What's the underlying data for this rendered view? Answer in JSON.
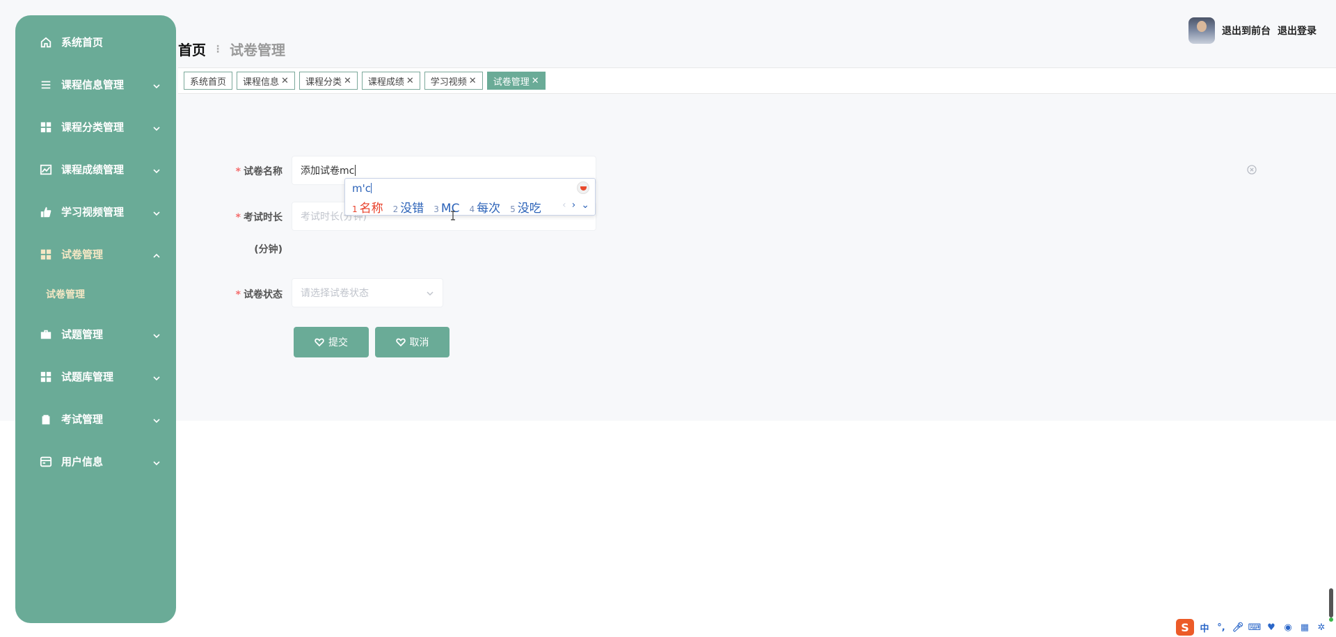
{
  "colors": {
    "accent": "#6aab97",
    "active_text": "#f5e7c4",
    "required": "#f56c6c",
    "ime_blue": "#2b62b8",
    "ime_red": "#e8402a"
  },
  "sidebar": {
    "items": [
      {
        "label": "系统首页",
        "icon": "home-icon"
      },
      {
        "label": "课程信息管理",
        "icon": "list-icon"
      },
      {
        "label": "课程分类管理",
        "icon": "grid-icon"
      },
      {
        "label": "课程成绩管理",
        "icon": "chart-icon"
      },
      {
        "label": "学习视频管理",
        "icon": "thumb-icon"
      },
      {
        "label": "试卷管理",
        "icon": "grid-icon"
      },
      {
        "label": "试题管理",
        "icon": "briefcase-icon"
      },
      {
        "label": "试题库管理",
        "icon": "grid-icon"
      },
      {
        "label": "考试管理",
        "icon": "clipboard-icon"
      },
      {
        "label": "用户信息",
        "icon": "card-icon"
      }
    ],
    "submenu": {
      "label": "试卷管理"
    }
  },
  "header": {
    "back_to_front": "退出到前台",
    "logout": "退出登录",
    "breadcrumb_home": "首页",
    "breadcrumb_current": "试卷管理"
  },
  "tabs": [
    {
      "label": "系统首页",
      "closable": false
    },
    {
      "label": "课程信息",
      "closable": true
    },
    {
      "label": "课程分类",
      "closable": true
    },
    {
      "label": "课程成绩",
      "closable": true
    },
    {
      "label": "学习视频",
      "closable": true
    },
    {
      "label": "试卷管理",
      "closable": true,
      "active": true
    }
  ],
  "form": {
    "name_label": "试卷名称",
    "name_value": "添加试卷mc",
    "duration_label": "考试时长",
    "duration_label_2": "(分钟)",
    "duration_placeholder": "考试时长(分钟)",
    "status_label": "试卷状态",
    "status_placeholder": "请选择试卷状态",
    "submit_label": "提交",
    "cancel_label": "取消"
  },
  "ime": {
    "composition": "m'c",
    "candidates": [
      {
        "num": "1",
        "text": "名称"
      },
      {
        "num": "2",
        "text": "没错"
      },
      {
        "num": "3",
        "text": "MC"
      },
      {
        "num": "4",
        "text": "每次"
      },
      {
        "num": "5",
        "text": "没吃"
      }
    ]
  },
  "tray": {
    "ime_mode": "中",
    "punct": "°,"
  }
}
